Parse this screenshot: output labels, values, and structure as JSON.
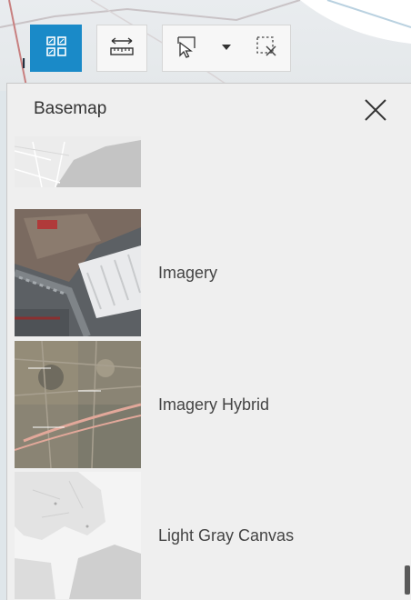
{
  "toolbar": {
    "basemap_icon": "grid-icon",
    "measure_icon": "measure-icon",
    "select_icon": "select-icon",
    "clear_icon": "clear-selection-icon",
    "accent": "#1a8ac8"
  },
  "map": {
    "label": "l"
  },
  "panel": {
    "title": "Basemap",
    "close_icon": "close-icon",
    "items": [
      {
        "label": ""
      },
      {
        "label": "Imagery"
      },
      {
        "label": "Imagery Hybrid"
      },
      {
        "label": "Light Gray Canvas"
      }
    ]
  }
}
